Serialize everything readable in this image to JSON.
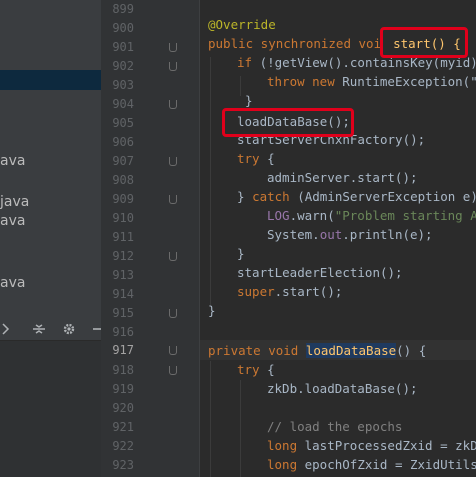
{
  "sidebar": {
    "files": [
      "ava",
      "java",
      "ava",
      "ava"
    ]
  },
  "gutter": {
    "lines": [
      "899",
      "900",
      "901",
      "902",
      "903",
      "904",
      "905",
      "906",
      "907",
      "908",
      "909",
      "910",
      "911",
      "912",
      "913",
      "914",
      "915",
      "916",
      "917",
      "918",
      "919",
      "920",
      "921",
      "922",
      "923"
    ],
    "current_line": "917"
  },
  "code": {
    "l900": "@Override",
    "l901_mod": "public synchronized voi",
    "l901_name": "start() {",
    "l902_if": "if",
    "l902_rest": " (!getView().containsKey(myid)",
    "l903_throw": "throw new",
    "l903_rest": " RuntimeException(\"",
    "l904": "}",
    "l905": "loadDataBase();",
    "l906": "startServerCnxnFactory();",
    "l907_try": "try",
    "l907_rest": " {",
    "l908": "adminServer.start();",
    "l909_a": "} ",
    "l909_catch": "catch",
    "l909_rest": " (AdminServerException e)",
    "l910_log": "LOG",
    "l910_mid": ".warn(",
    "l910_str": "\"Problem starting A",
    "l911_sys": "System.",
    "l911_out": "out",
    "l911_rest": ".println(e);",
    "l912": "}",
    "l913": "startLeaderElection();",
    "l914_super": "super",
    "l914_rest": ".start();",
    "l915": "}",
    "l917_mod": "private void ",
    "l917_name": "loadDataBase",
    "l917_rest": "() {",
    "l918_try": "try",
    "l918_rest": " {",
    "l919": "zkDb.loadDataBase();",
    "l921": "// load the epochs",
    "l922_kw": "long",
    "l922_rest": " lastProcessedZxid = zkD",
    "l923_kw": "long",
    "l923_rest": " epochOfZxid = ZxidUtils"
  },
  "colors": {
    "keyword": "#cc7832",
    "annotation": "#bbb529",
    "string": "#6a8759",
    "comment": "#808080",
    "field": "#9876aa",
    "highlight_box": "#e0001b"
  }
}
